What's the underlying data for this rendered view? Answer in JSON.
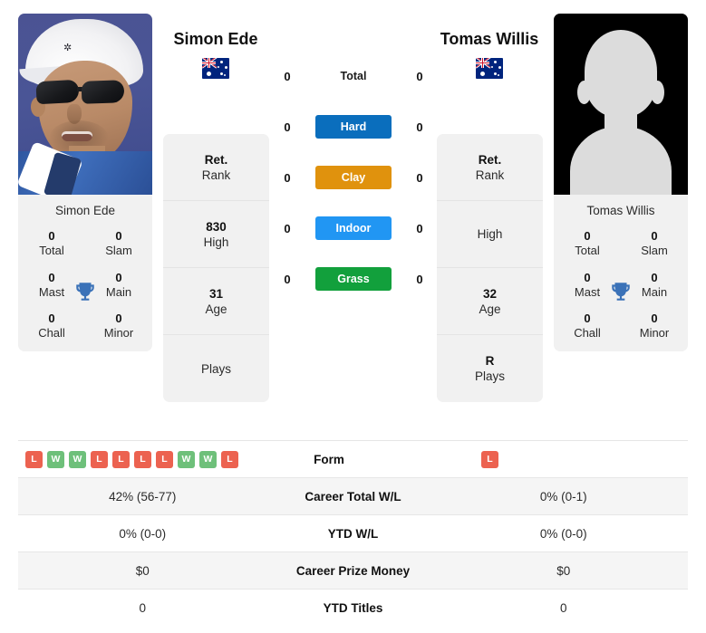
{
  "players": {
    "left": {
      "name": "Simon Ede",
      "flag": "australia-flag",
      "photo": "player-photo",
      "card_name": "Simon Ede",
      "titles": [
        {
          "value": "0",
          "label": "Total"
        },
        {
          "value": "0",
          "label": "Slam"
        },
        {
          "value": "0",
          "label": "Mast"
        },
        {
          "value": "0",
          "label": "Main"
        },
        {
          "value": "0",
          "label": "Chall"
        },
        {
          "value": "0",
          "label": "Minor"
        }
      ],
      "stats": [
        {
          "value": "Ret.",
          "label": "Rank"
        },
        {
          "value": "830",
          "label": "High"
        },
        {
          "value": "31",
          "label": "Age"
        },
        {
          "value": "",
          "label": "Plays"
        }
      ],
      "surface_counts": [
        "0",
        "0",
        "0",
        "0",
        "0"
      ],
      "form": [
        "L",
        "W",
        "W",
        "L",
        "L",
        "L",
        "L",
        "W",
        "W",
        "L"
      ],
      "career_total_wl": "42% (56-77)",
      "ytd_wl": "0% (0-0)",
      "career_prize_money": "$0",
      "ytd_titles": "0"
    },
    "right": {
      "name": "Tomas Willis",
      "flag": "australia-flag",
      "photo": "placeholder-avatar",
      "card_name": "Tomas Willis",
      "titles": [
        {
          "value": "0",
          "label": "Total"
        },
        {
          "value": "0",
          "label": "Slam"
        },
        {
          "value": "0",
          "label": "Mast"
        },
        {
          "value": "0",
          "label": "Main"
        },
        {
          "value": "0",
          "label": "Chall"
        },
        {
          "value": "0",
          "label": "Minor"
        }
      ],
      "stats": [
        {
          "value": "Ret.",
          "label": "Rank"
        },
        {
          "value": "",
          "label": "High"
        },
        {
          "value": "32",
          "label": "Age"
        },
        {
          "value": "R",
          "label": "Plays"
        }
      ],
      "surface_counts": [
        "0",
        "0",
        "0",
        "0",
        "0"
      ],
      "form": [
        "L"
      ],
      "career_total_wl": "0% (0-1)",
      "ytd_wl": "0% (0-0)",
      "career_prize_money": "$0",
      "ytd_titles": "0"
    }
  },
  "surfaces": [
    {
      "label": "Total",
      "color": "transparent",
      "plain": true
    },
    {
      "label": "Hard",
      "color": "#0a6ebd"
    },
    {
      "label": "Clay",
      "color": "#e0920d"
    },
    {
      "label": "Indoor",
      "color": "#2196f3"
    },
    {
      "label": "Grass",
      "color": "#12a03c"
    }
  ],
  "table_rows": [
    {
      "label": "Form"
    },
    {
      "label": "Career Total W/L"
    },
    {
      "label": "YTD W/L"
    },
    {
      "label": "Career Prize Money"
    },
    {
      "label": "YTD Titles"
    }
  ],
  "colors": {
    "hard": "#0a6ebd",
    "clay": "#e0920d",
    "indoor": "#2196f3",
    "grass": "#12a03c",
    "win": "#6ec07a",
    "loss": "#ec6250",
    "trophy": "#3b72b8",
    "card_bg": "#f1f1f1"
  }
}
